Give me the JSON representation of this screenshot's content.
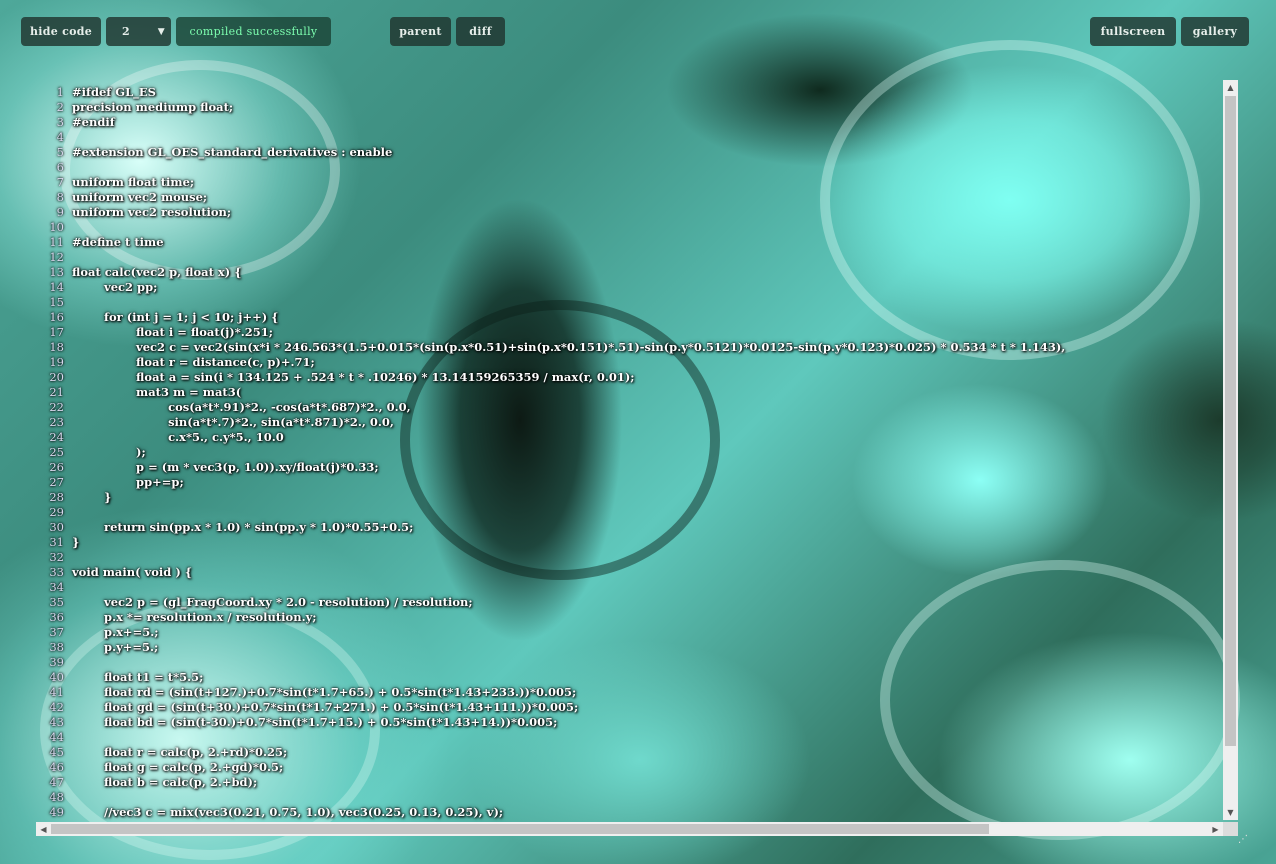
{
  "toolbar": {
    "hide_code": "hide code",
    "version_select": "2",
    "status": "compiled successfully",
    "parent": "parent",
    "diff": "diff",
    "fullscreen": "fullscreen",
    "gallery": "gallery"
  },
  "colors": {
    "status_text": "#7dffb0",
    "button_bg": "#20342e",
    "scrollbar": "#efefef"
  },
  "code": [
    {
      "n": "1",
      "t": "#ifdef GL_ES"
    },
    {
      "n": "2",
      "t": "precision mediump float;"
    },
    {
      "n": "3",
      "t": "#endif"
    },
    {
      "n": "4",
      "t": ""
    },
    {
      "n": "5",
      "t": "#extension GL_OES_standard_derivatives : enable"
    },
    {
      "n": "6",
      "t": ""
    },
    {
      "n": "7",
      "t": "uniform float time;"
    },
    {
      "n": "8",
      "t": "uniform vec2 mouse;"
    },
    {
      "n": "9",
      "t": "uniform vec2 resolution;"
    },
    {
      "n": "10",
      "t": ""
    },
    {
      "n": "11",
      "t": "#define t time"
    },
    {
      "n": "12",
      "t": ""
    },
    {
      "n": "13",
      "t": "float calc(vec2 p, float x) {"
    },
    {
      "n": "14",
      "t": "        vec2 pp;"
    },
    {
      "n": "15",
      "t": ""
    },
    {
      "n": "16",
      "t": "        for (int j = 1; j < 10; j++) {"
    },
    {
      "n": "17",
      "t": "                float i = float(j)*.251;"
    },
    {
      "n": "18",
      "t": "                vec2 c = vec2(sin(x*i * 246.563*(1.5+0.015*(sin(p.x*0.51)+sin(p.x*0.151)*.51)-sin(p.y*0.5121)*0.0125-sin(p.y*0.123)*0.025) * 0.534 * t * 1.143),"
    },
    {
      "n": "19",
      "t": "                float r = distance(c, p)+.71;"
    },
    {
      "n": "20",
      "t": "                float a = sin(i * 134.125 + .524 * t * .10246) * 13.14159265359 / max(r, 0.01);"
    },
    {
      "n": "21",
      "t": "                mat3 m = mat3("
    },
    {
      "n": "22",
      "t": "                        cos(a*t*.91)*2., -cos(a*t*.687)*2., 0.0,"
    },
    {
      "n": "23",
      "t": "                        sin(a*t*.7)*2., sin(a*t*.871)*2., 0.0,"
    },
    {
      "n": "24",
      "t": "                        c.x*5., c.y*5., 10.0"
    },
    {
      "n": "25",
      "t": "                );"
    },
    {
      "n": "26",
      "t": "                p = (m * vec3(p, 1.0)).xy/float(j)*0.33;"
    },
    {
      "n": "27",
      "t": "                pp+=p;"
    },
    {
      "n": "28",
      "t": "        }"
    },
    {
      "n": "29",
      "t": ""
    },
    {
      "n": "30",
      "t": "        return sin(pp.x * 1.0) * sin(pp.y * 1.0)*0.55+0.5;"
    },
    {
      "n": "31",
      "t": "}"
    },
    {
      "n": "32",
      "t": ""
    },
    {
      "n": "33",
      "t": "void main( void ) {"
    },
    {
      "n": "34",
      "t": ""
    },
    {
      "n": "35",
      "t": "        vec2 p = (gl_FragCoord.xy * 2.0 - resolution) / resolution;"
    },
    {
      "n": "36",
      "t": "        p.x *= resolution.x / resolution.y;"
    },
    {
      "n": "37",
      "t": "        p.x+=5.;"
    },
    {
      "n": "38",
      "t": "        p.y+=5.;"
    },
    {
      "n": "39",
      "t": ""
    },
    {
      "n": "40",
      "t": "        float t1 = t*5.5;"
    },
    {
      "n": "41",
      "t": "        float rd = (sin(t+127.)+0.7*sin(t*1.7+65.) + 0.5*sin(t*1.43+233.))*0.005;"
    },
    {
      "n": "42",
      "t": "        float gd = (sin(t+30.)+0.7*sin(t*1.7+271.) + 0.5*sin(t*1.43+111.))*0.005;"
    },
    {
      "n": "43",
      "t": "        float bd = (sin(t-30.)+0.7*sin(t*1.7+15.) + 0.5*sin(t*1.43+14.))*0.005;"
    },
    {
      "n": "44",
      "t": ""
    },
    {
      "n": "45",
      "t": "        float r = calc(p, 2.+rd)*0.25;"
    },
    {
      "n": "46",
      "t": "        float g = calc(p, 2.+gd)*0.5;"
    },
    {
      "n": "47",
      "t": "        float b = calc(p, 2.+bd);"
    },
    {
      "n": "48",
      "t": ""
    },
    {
      "n": "49",
      "t": "        //vec3 c = mix(vec3(0.21, 0.75, 1.0), vec3(0.25, 0.13, 0.25), v);"
    }
  ]
}
